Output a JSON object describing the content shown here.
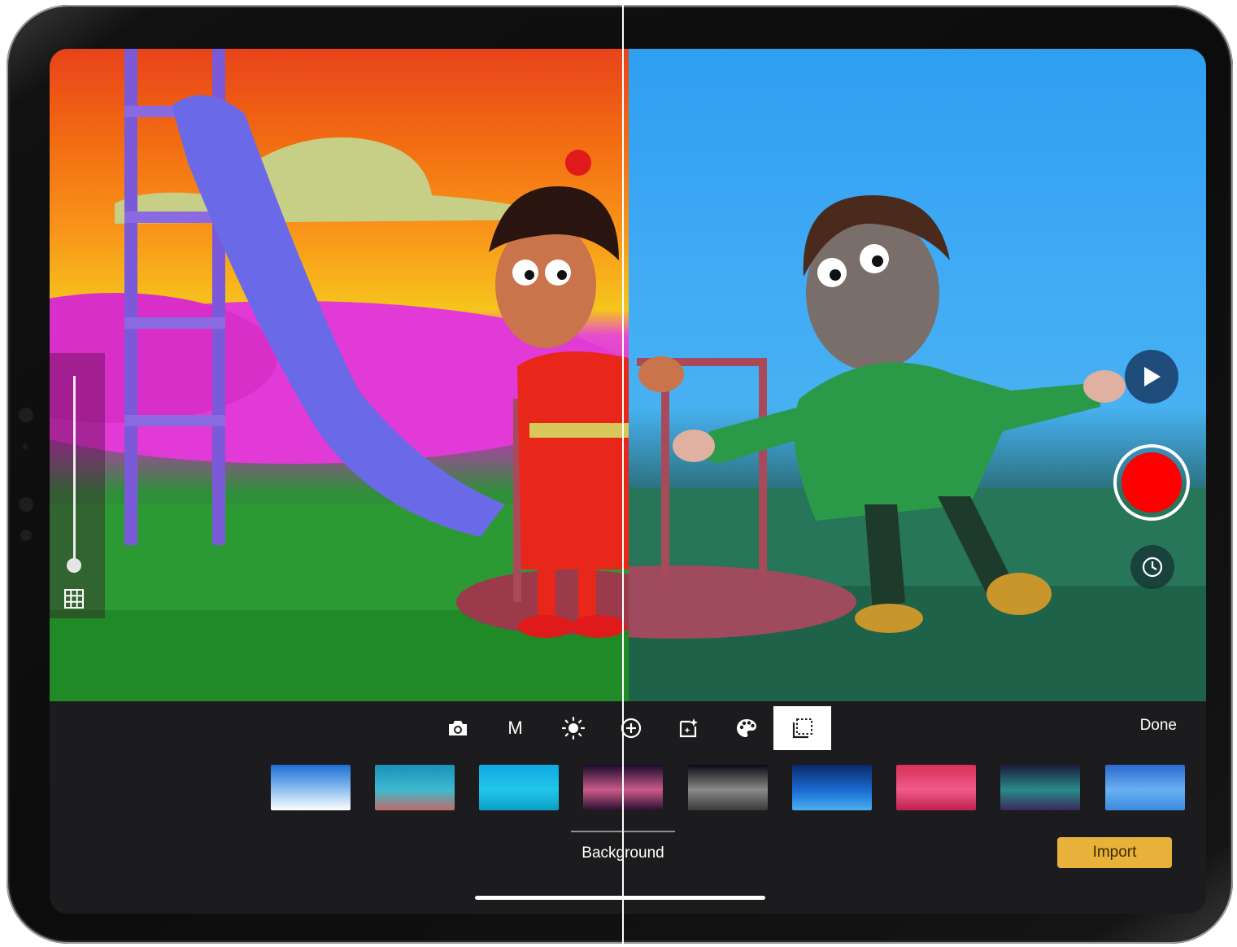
{
  "toolbar": {
    "tools": [
      {
        "name": "camera-icon"
      },
      {
        "name": "manual",
        "label": "M"
      },
      {
        "name": "brightness-icon"
      },
      {
        "name": "focus-add-icon"
      },
      {
        "name": "effects-icon"
      },
      {
        "name": "palette-icon"
      },
      {
        "name": "background-icon",
        "active": true
      }
    ],
    "done_label": "Done"
  },
  "backgrounds": {
    "label": "Background",
    "import_label": "Import",
    "thumbnails": [
      {
        "name": "sky-clouds-thumbnail",
        "colors": [
          "#1d6fd6",
          "#8fc0ee",
          "#ffffff"
        ]
      },
      {
        "name": "coral-reef-thumbnail",
        "colors": [
          "#1a8fb8",
          "#3cbad0",
          "#c06a6a"
        ]
      },
      {
        "name": "ocean-thumbnail",
        "colors": [
          "#0fa8e6",
          "#23c6e8",
          "#0a9fc6"
        ]
      },
      {
        "name": "planet-thumbnail",
        "colors": [
          "#1a0a2a",
          "#c85a8a",
          "#2a1030"
        ]
      },
      {
        "name": "moon-surface-thumbnail",
        "colors": [
          "#0a0a14",
          "#8a8a8a",
          "#3a3a3a"
        ]
      },
      {
        "name": "blue-gradient-thumbnail",
        "colors": [
          "#0a2a6a",
          "#1a6ad0",
          "#4ab0f0"
        ]
      },
      {
        "name": "pink-bokeh-thumbnail",
        "colors": [
          "#d8305a",
          "#f05a8a",
          "#c02050"
        ]
      },
      {
        "name": "nebula-thumbnail",
        "colors": [
          "#1a1a3a",
          "#2a8a8a",
          "#3a2a5a"
        ]
      },
      {
        "name": "blue-pattern-thumbnail",
        "colors": [
          "#2a6ad0",
          "#6ab0f0",
          "#3a8ae0"
        ]
      }
    ]
  },
  "colors": {
    "accent_import": "#e8b13a",
    "record": "#ff0000",
    "play_button": "#1f4c7a",
    "toolbar_bg": "#1c1c1e"
  }
}
